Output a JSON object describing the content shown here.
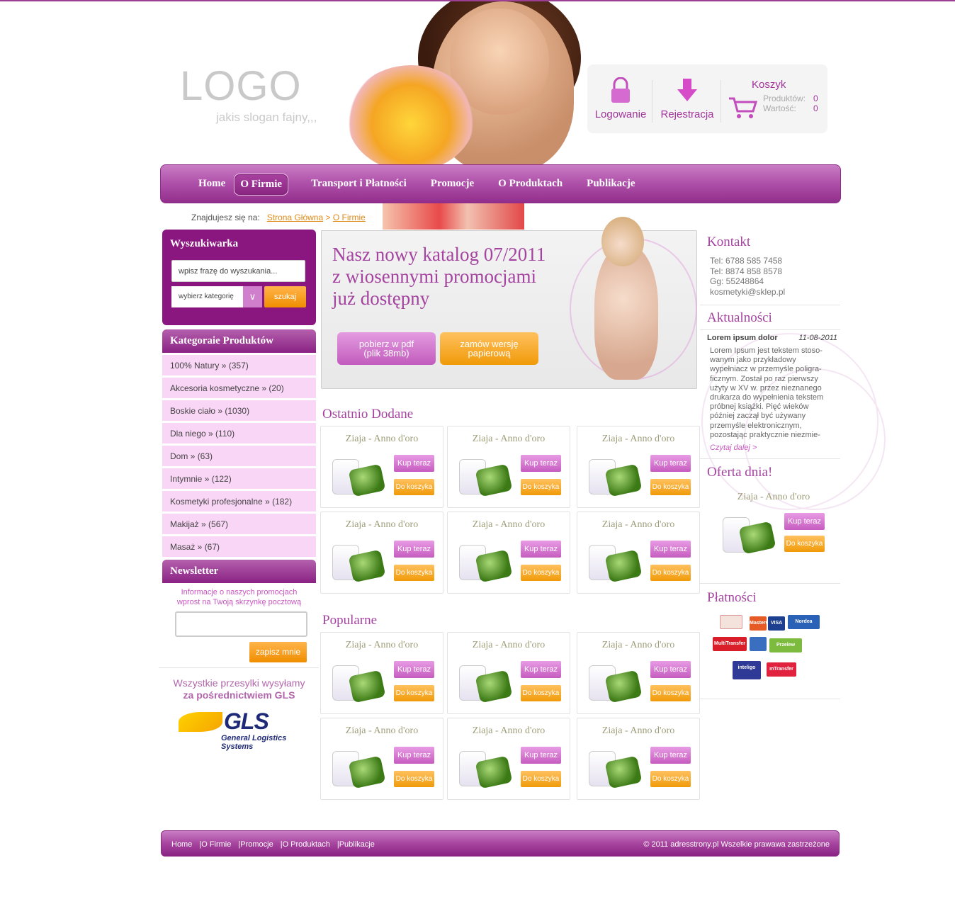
{
  "header": {
    "logo": "LOGO",
    "slogan": "jakis slogan fajny,,,",
    "login_label": "Logowanie",
    "register_label": "Rejestracja",
    "cart": {
      "title": "Koszyk",
      "products_label": "Produktów:",
      "products_value": "0",
      "value_label": "Wartość:",
      "value_value": "0"
    }
  },
  "nav": {
    "items": [
      "Home",
      "O Firmie",
      "Transport i Płatności",
      "Promocje",
      "O Produktach",
      "Publikacje"
    ],
    "active_index": 1
  },
  "breadcrumb": {
    "prefix": "Znajdujesz się na:",
    "home": "Strona Główna",
    "sep": ">",
    "current": "O Firmie"
  },
  "search": {
    "title": "Wyszukiwarka",
    "placeholder": "wpisz frazę do wyszukania...",
    "category_placeholder": "wybierz kategorię",
    "button": "szukaj"
  },
  "categories": {
    "title": "Kategoraie Produktów",
    "items": [
      {
        "name": "100% Natury",
        "count": "(357)"
      },
      {
        "name": "Akcesoria kosmetyczne",
        "count": "(20)"
      },
      {
        "name": "Boskie ciało",
        "count": "(1030)"
      },
      {
        "name": "Dla niego",
        "count": "(110)"
      },
      {
        "name": "Dom",
        "count": "(63)"
      },
      {
        "name": "Intymnie",
        "count": "(122)"
      },
      {
        "name": "Kosmetyki profesjonalne",
        "count": "(182)"
      },
      {
        "name": "Makijaż",
        "count": "(567)"
      },
      {
        "name": "Masaż",
        "count": "(67)"
      }
    ]
  },
  "newsletter": {
    "title": "Newsletter",
    "info_line1": "Informacje o naszych promocjach",
    "info_line2": "wprost na Twoją skrzynkę pocztową",
    "button": "zapisz mnie"
  },
  "shipping": {
    "line1": "Wszystkie przesylki wysyłamy",
    "line2": "za pośrednictwiem GLS",
    "logo_text": "GLS",
    "logo_sub": "General Logistics Systems"
  },
  "banner": {
    "title_line1": "Nasz nowy katalog 07/2011",
    "title_line2": "z wiosennymi promocjami",
    "title_line3": "już dostępny",
    "btn_pdf_line1": "pobierz w pdf",
    "btn_pdf_line2": "(plik 38mb)",
    "btn_paper_line1": "zamów wersję",
    "btn_paper_line2": "papierową"
  },
  "sections": {
    "recent": "Ostatnio Dodane",
    "popular": "Popularne"
  },
  "product": {
    "name": "Ziaja - Anno d'oro",
    "buy": "Kup teraz",
    "cart": "Do koszyka"
  },
  "contact": {
    "title": "Kontakt",
    "tel1": "Tel: 6788 585 7458",
    "tel2": "Tel: 8874 858 8578",
    "gg": "Gg: 55248864",
    "email": "kosmetyki@sklep.pl"
  },
  "news": {
    "title": "Aktualności",
    "item_title": "Lorem ipsum dolor",
    "item_date": "11-08-2011",
    "body_lines": [
      "Lorem Ipsum jest tekstem stoso-",
      "wanym jako przykładowy",
      "wypełniacz w przemyśle poligra-",
      "ficznym. Został po raz pierwszy",
      "użyty w XV w. przez nieznanego",
      "drukarza do wypełnienia tekstem",
      "próbnej książki. Pięć wieków",
      "później zaczął być używany",
      "przemyśle elektronicznym,",
      "pozostając praktycznie niezmie-"
    ],
    "more": "Czytaj dalej >"
  },
  "offer": {
    "title": "Oferta dnia!",
    "name": "Ziaja - Anno d'oro",
    "buy": "Kup teraz",
    "cart": "Do koszyka"
  },
  "payments": {
    "title": "Płatności",
    "logos": [
      "MasterCard",
      "VISA",
      "Nordea",
      "MultiTransfer",
      "Przelew",
      "inteligo",
      "mTransfer"
    ]
  },
  "footer": {
    "links": [
      "Home",
      "O Firmie",
      "Promocje",
      "O Produktach",
      "Publikacje"
    ],
    "copyright": "©  2011 adresstrony.pl    Wszelkie prawawa zastrzeżone"
  },
  "colors": {
    "brand": "#a444a0",
    "accent": "#f09a08",
    "nav": "#922e8c"
  }
}
